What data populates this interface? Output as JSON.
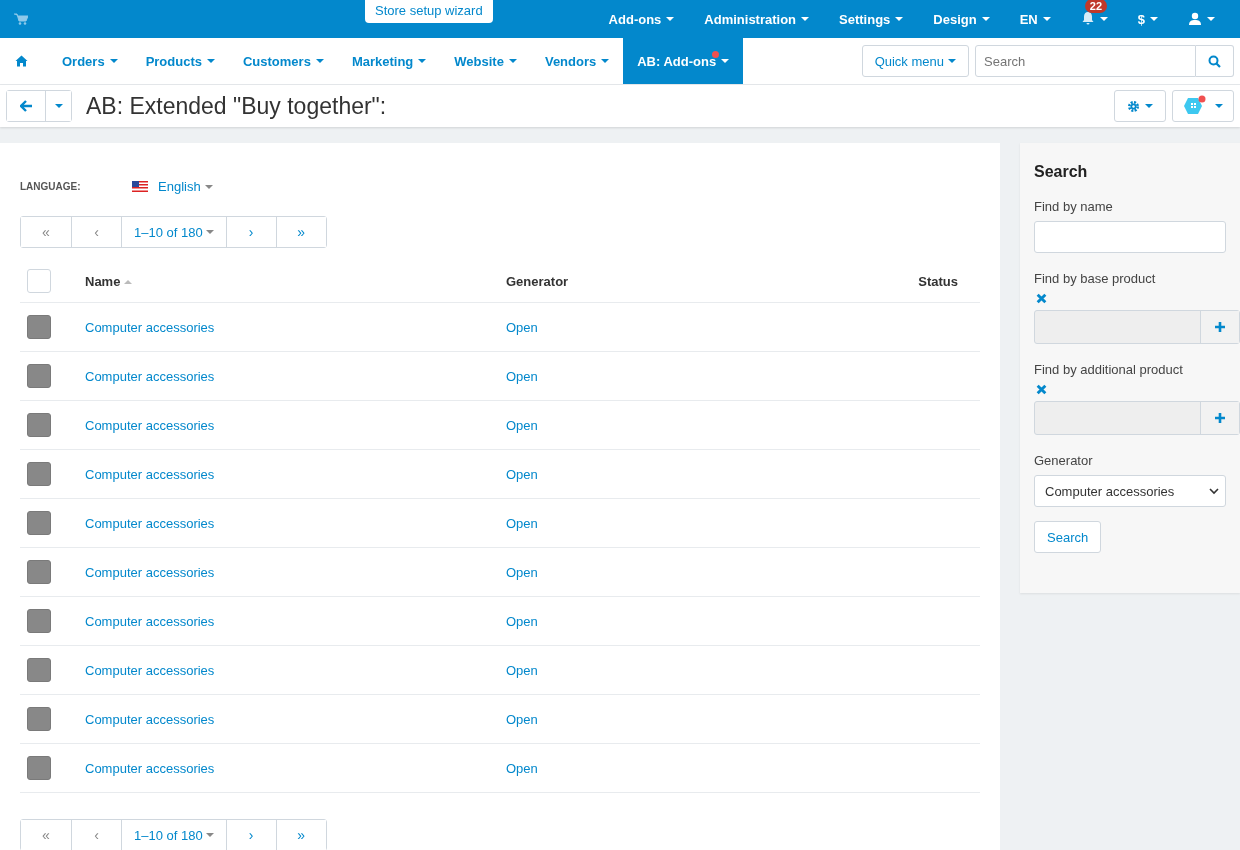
{
  "topbar": {
    "wizard": "Store setup wizard",
    "menus": [
      {
        "label": "Add-ons"
      },
      {
        "label": "Administration"
      },
      {
        "label": "Settings"
      },
      {
        "label": "Design"
      },
      {
        "label": "EN"
      }
    ],
    "notifications": "22",
    "currency": "$"
  },
  "nav": {
    "items": [
      {
        "label": "Orders",
        "selected": false,
        "dot": false
      },
      {
        "label": "Products",
        "selected": false,
        "dot": false
      },
      {
        "label": "Customers",
        "selected": false,
        "dot": false
      },
      {
        "label": "Marketing",
        "selected": false,
        "dot": false
      },
      {
        "label": "Website",
        "selected": false,
        "dot": false
      },
      {
        "label": "Vendors",
        "selected": false,
        "dot": false
      },
      {
        "label": "AB: Add-ons",
        "selected": true,
        "dot": true
      }
    ],
    "quick_menu": "Quick menu",
    "search": {
      "placeholder": "Search"
    }
  },
  "page": {
    "title": "AB: Extended \"Buy together\":"
  },
  "language": {
    "label": "LANGUAGE:",
    "value": "English"
  },
  "pagination_top": {
    "first": "«",
    "prev": "‹",
    "range": "1–10 of 180",
    "next": "›",
    "last": "»"
  },
  "table": {
    "columns": [
      "Name",
      "Generator",
      "Status"
    ],
    "header_checked": false,
    "rows": [
      {
        "name": "Computer accessories",
        "generator": "Open",
        "disabled": true
      },
      {
        "name": "Computer accessories",
        "generator": "Open",
        "disabled": true
      },
      {
        "name": "Computer accessories",
        "generator": "Open",
        "disabled": true
      },
      {
        "name": "Computer accessories",
        "generator": "Open",
        "disabled": true
      },
      {
        "name": "Computer accessories",
        "generator": "Open",
        "disabled": true
      },
      {
        "name": "Computer accessories",
        "generator": "Open",
        "disabled": true
      },
      {
        "name": "Computer accessories",
        "generator": "Open",
        "disabled": true
      },
      {
        "name": "Computer accessories",
        "generator": "Open",
        "disabled": true
      },
      {
        "name": "Computer accessories",
        "generator": "Open",
        "disabled": true
      },
      {
        "name": "Computer accessories",
        "generator": "Open",
        "disabled": true
      }
    ]
  },
  "pagination_bottom": {
    "first": "«",
    "prev": "‹",
    "range": "1–10 of 180",
    "next": "›",
    "last": "»"
  },
  "sidebar": {
    "title": "Search",
    "fields": [
      {
        "kind": "text",
        "label": "Find by name"
      },
      {
        "kind": "picker",
        "label": "Find by base product"
      },
      {
        "kind": "picker",
        "label": "Find by additional product"
      },
      {
        "kind": "select",
        "label": "Generator",
        "value": "Computer accessories"
      }
    ],
    "button": "Search"
  }
}
